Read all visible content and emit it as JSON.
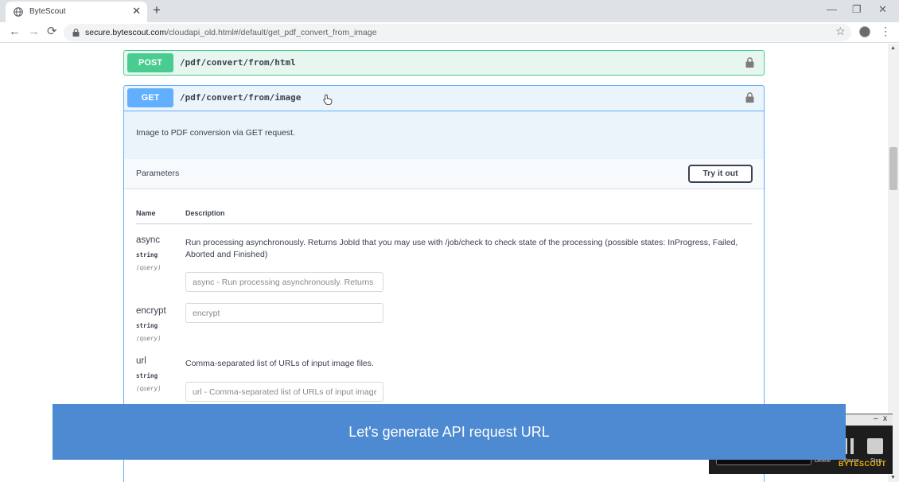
{
  "browser": {
    "tab_title": "ByteScout",
    "tab_close": "✕",
    "new_tab": "+",
    "url_host": "secure.bytescout.com",
    "url_path": "/cloudapi_old.html#/default/get_pdf_convert_from_image",
    "win_minimize": "—",
    "win_restore": "❐",
    "win_close": "✕",
    "back": "←",
    "forward": "→",
    "reload": "⟳",
    "star": "☆",
    "menu": "⋮"
  },
  "post_op": {
    "method": "POST",
    "path": "/pdf/convert/from/html"
  },
  "get_op": {
    "method": "GET",
    "path": "/pdf/convert/from/image",
    "description": "Image to PDF conversion via GET request.",
    "parameters_title": "Parameters",
    "try_label": "Try it out",
    "col_name": "Name",
    "col_description": "Description",
    "params": [
      {
        "name": "async",
        "type": "string",
        "in": "(query)",
        "description": "Run processing asynchronously. Returns JobId that you may use with /job/check to check state of the processing (possible states: InProgress, Failed, Aborted and Finished)",
        "placeholder": "async - Run processing asynchronously. Returns Jc"
      },
      {
        "name": "encrypt",
        "type": "string",
        "in": "(query)",
        "description": "",
        "placeholder": "encrypt"
      },
      {
        "name": "url",
        "type": "string",
        "in": "(query)",
        "description": "Comma-separated list of URLs of input image files.",
        "placeholder": "url - Comma-separated list of URLs of input image f"
      }
    ]
  },
  "caption": "Let's generate API request URL",
  "recorder": {
    "minimize": "–",
    "close": "x",
    "delete_label": "Delete",
    "pause_label": "Pause",
    "stop_label": "Stop",
    "brand": "BYTESCOUT"
  },
  "colors": {
    "post": "#49cc90",
    "get": "#61affe",
    "caption_bg": "#4d8ad1"
  },
  "icons": {
    "tab": "globe-icon",
    "lock": "lock-icon",
    "cursor": "hand-cursor-icon"
  }
}
